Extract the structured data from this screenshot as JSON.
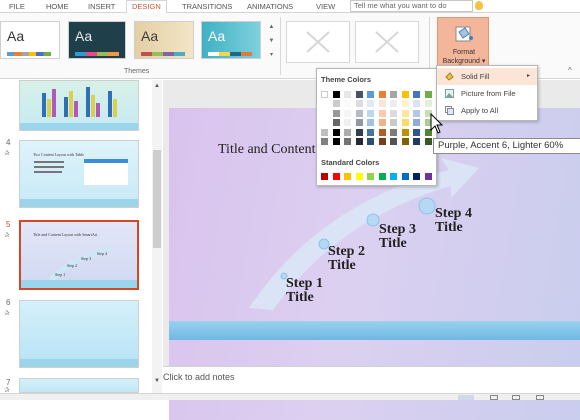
{
  "tabs": [
    "FILE",
    "HOME",
    "INSERT",
    "DESIGN",
    "TRANSITIONS",
    "ANIMATIONS",
    "VIEW"
  ],
  "active_tab": "DESIGN",
  "tell_me_placeholder": "Tell me what you want to do",
  "ribbon": {
    "themes_group_label": "Themes",
    "theme_aa": "Aa",
    "format_background_label_1": "Format",
    "format_background_label_2": "Background ▾"
  },
  "slides": [
    {
      "number": "4",
      "title": "Two Content Layout with Table"
    },
    {
      "number": "5",
      "title": "Title and Content Layout with SmartArt"
    },
    {
      "number": "6"
    },
    {
      "number": "7"
    }
  ],
  "main_slide": {
    "title": "Title and Content",
    "steps": [
      "Step 1 Title",
      "Step 2 Title",
      "Step 3 Title",
      "Step 4 Title"
    ]
  },
  "notes_placeholder": "Click to add notes",
  "color_panel": {
    "theme_colors_label": "Theme Colors",
    "standard_colors_label": "Standard Colors",
    "theme_columns": [
      "#ffffff",
      "#000000",
      "#e7e6e6",
      "#44546a",
      "#5b9bd5",
      "#ed7d31",
      "#a5a5a5",
      "#ffc000",
      "#4472c4",
      "#70ad47"
    ],
    "standard_colors": [
      "#c00000",
      "#ff0000",
      "#ffc000",
      "#ffff00",
      "#92d050",
      "#00b050",
      "#00b0f0",
      "#0070c0",
      "#002060",
      "#7030a0"
    ]
  },
  "submenu": {
    "solid_fill": "Solid Fill",
    "picture_from_file": "Picture from File",
    "apply_to_all": "Apply to All"
  },
  "tooltip": "Purple, Accent 6, Lighter 60%",
  "accent_color": "#d24726"
}
